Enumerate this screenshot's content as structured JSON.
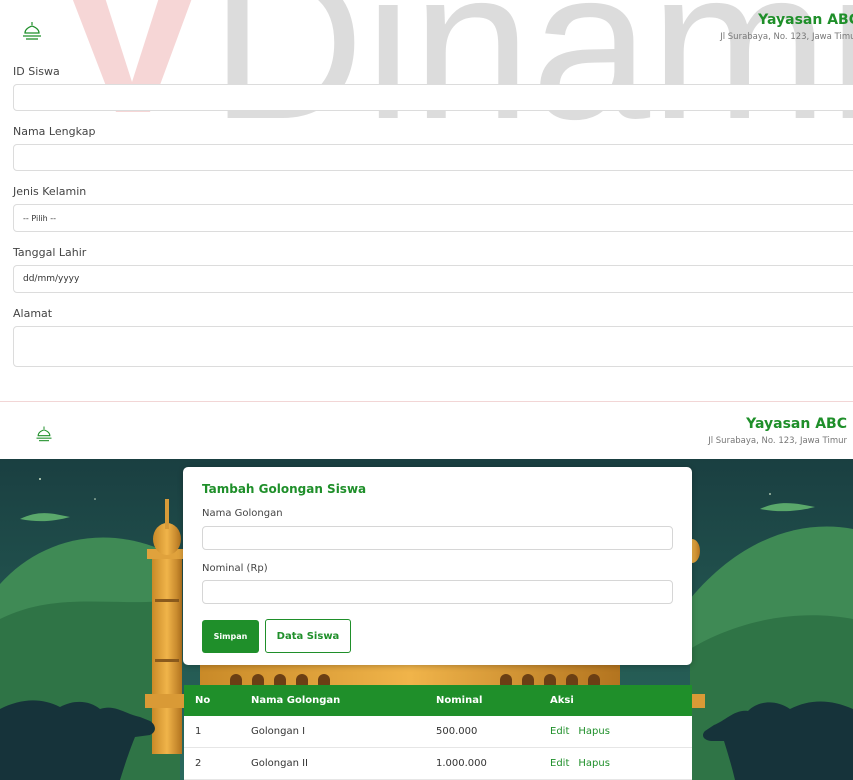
{
  "brand": {
    "name": "Yayasan ABC",
    "address": "Jl Surabaya, No. 123, Jawa Timur"
  },
  "watermark_text": "Dinami",
  "student_form": {
    "fields": [
      {
        "label": "ID Siswa",
        "value": ""
      },
      {
        "label": "Nama Lengkap",
        "value": ""
      },
      {
        "label": "Jenis Kelamin",
        "value": "-- Pilih --"
      },
      {
        "label": "Tanggal Lahir",
        "value": "dd/mm/yyyy"
      },
      {
        "label": "Alamat",
        "value": ""
      }
    ]
  },
  "golongan_form": {
    "title": "Tambah Golongan Siswa",
    "nama_label": "Nama Golongan",
    "nama_value": "",
    "nominal_label": "Nominal (Rp)",
    "nominal_value": "",
    "save_label": "Simpan",
    "data_siswa_label": "Data Siswa"
  },
  "table": {
    "headers": [
      "No",
      "Nama Golongan",
      "Nominal",
      "Aksi"
    ],
    "rows": [
      {
        "no": "1",
        "nama": "Golongan I",
        "nominal": "500.000",
        "edit": "Edit",
        "hapus": "Hapus"
      },
      {
        "no": "2",
        "nama": "Golongan II",
        "nominal": "1.000.000",
        "edit": "Edit",
        "hapus": "Hapus"
      }
    ]
  },
  "colors": {
    "accent": "#1f8f2a",
    "scene_sky": "#1d4a4a"
  },
  "icons": {
    "logo": "mosque-dome-icon"
  }
}
